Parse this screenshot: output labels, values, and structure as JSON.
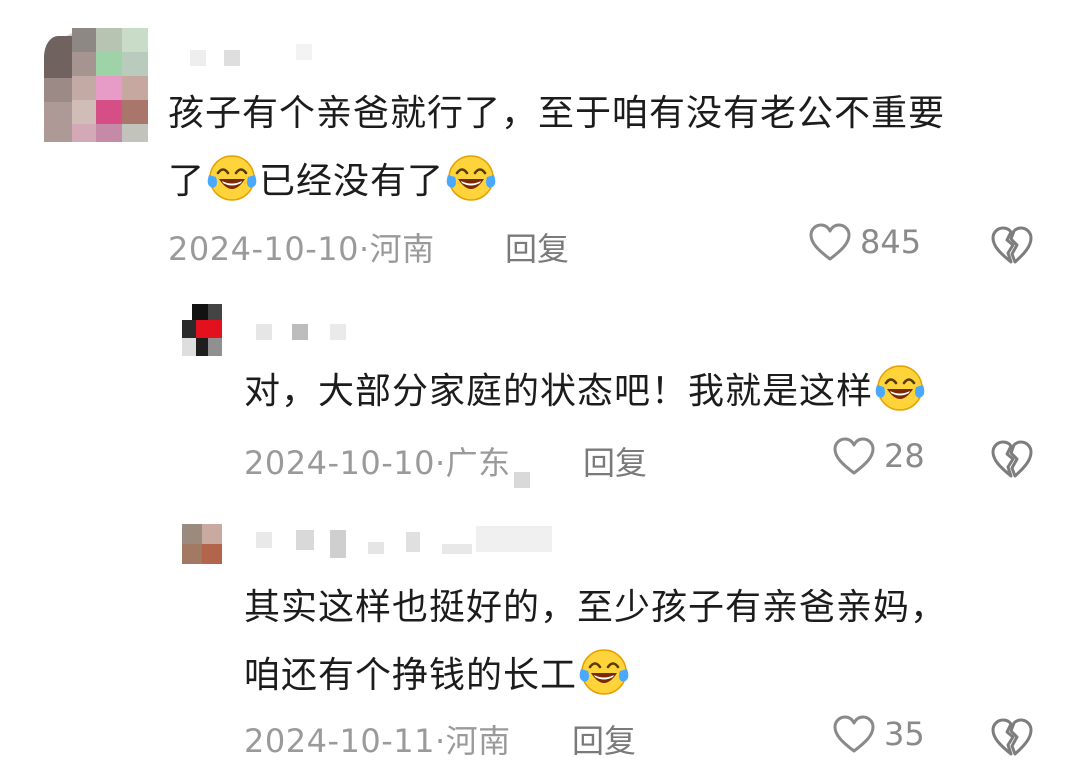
{
  "comments": [
    {
      "text_lines": [
        "孩子有个亲爸就行了，至于咱有没有老公不重要",
        "了",
        "已经没有了"
      ],
      "date": "2024-10-10",
      "location": "河南",
      "reply_label": "回复",
      "likes": "845",
      "emoji": "laughing-crying-emoji"
    },
    {
      "text_main": "对，大部分家庭的状态吧！我就是这样",
      "date": "2024-10-10",
      "location": "广东",
      "reply_label": "回复",
      "likes": "28",
      "emoji": "laughing-crying-emoji"
    },
    {
      "text_lines": [
        "其实这样也挺好的，至少孩子有亲爸亲妈，",
        "咱还有个挣钱的长工"
      ],
      "date": "2024-10-11",
      "location": "河南",
      "reply_label": "回复",
      "likes": "35",
      "emoji": "laughing-crying-emoji"
    }
  ],
  "separator": "·",
  "icons": {
    "like": "heart-outline-icon",
    "dislike": "broken-heart-icon"
  },
  "colors": {
    "meta_text": "#9a9a9a",
    "reply_text": "#7a7a7a",
    "body_text": "#1c1c1c",
    "emoji_face": "#ffd43b"
  }
}
